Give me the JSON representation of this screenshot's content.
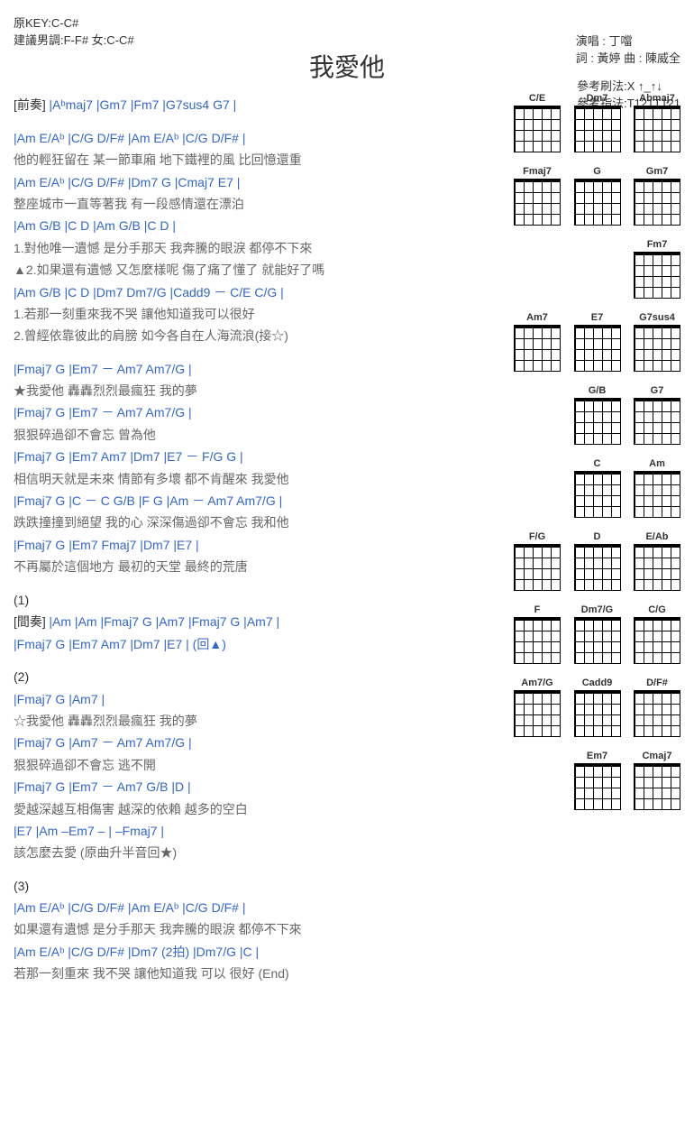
{
  "header": {
    "title": "我愛他",
    "original_key": "原KEY:C-C#",
    "suggest_key": "建議男調:F-F# 女:C-C#",
    "singer": "演唱 : 丁噹",
    "lyrics_composer": "詞 : 黃婷  曲 : 陳威全",
    "ref_strum": "參考刷法:X ↑_↑↓",
    "ref_finger": "參考指法:T121T121"
  },
  "intro": {
    "label": "[前奏]",
    "chords": " |Aᵇmaj7    |Gm7    |Fm7    |G7sus4    G7    |"
  },
  "verse1": [
    {
      "c": "|Am    E/Aᵇ    |C/G    D/F#    |Am    E/Aᵇ    |C/G    D/F#    |",
      "l": "他的輕狂留在    某一節車廂    地下鐵裡的風    比回憶還重"
    },
    {
      "c": "|Am    E/Aᵇ    |C/G    D/F#    |Dm7        G    |Cmaj7    E7    |",
      "l": "整座城市一直等著我        有一段感情還在漂泊"
    },
    {
      "c": "|Am        G/B    |C            D    |Am        G/B    |C            D    |",
      "l1": "1.對他唯一遺憾    是分手那天   我奔騰的眼淚    都停不下來",
      "l2": "▲2.如果還有遺憾    又怎麼樣呢    傷了痛了懂了    就能好了嗎"
    },
    {
      "c": "|Am        G/B    |C        D        |Dm7    Dm7/G    |Cadd9 － C/E    C/G  |",
      "l1": "1.若那一刻重來我不哭        讓他知道我可以很好",
      "l2": "2.曾經依靠彼此的肩膀        如今各自在人海流浪(接☆)"
    }
  ],
  "chorus": [
    {
      "pre": "                 |Fmaj7    G    |Em7 － Am7    Am7/G    |",
      "l": "★我愛他    轟轟烈烈最瘋狂      我的夢"
    },
    {
      "c": "|Fmaj7    G        |Em7 － Am7    Am7/G    |",
      "l": "狠狠碎過卻不會忘        曾為他"
    },
    {
      "c": "|Fmaj7    G        |Em7        Am7        |Dm7    |E7  －  F/G    G    |",
      "l": "相信明天就是未來    情節有多壞        都不肯醒來      我愛他"
    },
    {
      "c": "|Fmaj7    G    |C  －  C    G/B    |F      G       |Am  －  Am7    Am7/G  |",
      "l": "跌跌撞撞到絕望      我的心       深深傷過卻不會忘          我和他"
    },
    {
      "c": "|Fmaj7    G    |Em7    Fmaj7    |Dm7        |E7                |",
      "l": "不再屬於這個地方    最初的天堂    最終的荒唐"
    }
  ],
  "section1": {
    "label": "(1)"
  },
  "interlude": {
    "label": "[間奏]",
    "c1": " |Am    |Am    |Fmaj7    G    |Am7    |Fmaj7    G    |Am7    |",
    "c2": "            |Fmaj7    G    |Em7    Am7    |Dm7    |E7    |    (回▲)"
  },
  "section2": {
    "label": "(2)"
  },
  "chorus2": [
    {
      "pre": "                 |Fmaj7    G    |Am7    |",
      "l": "☆我愛他    轟轟烈烈最瘋狂      我的夢"
    },
    {
      "c": "|Fmaj7    G        |Am7 － Am7    Am7/G    |",
      "l": "狠狠碎過卻不會忘        逃不開"
    },
    {
      "c": "|Fmaj7    G        |Em7 － Am7    G/B    |D                |",
      "l": "愛越深越互相傷害    越深的依賴        越多的空白"
    },
    {
      "c": "|E7             |Am  –Em7 – | –Fmaj7  |",
      "l": "該怎麼去愛                                        (原曲升半音回★)"
    }
  ],
  "section3": {
    "label": "(3)"
  },
  "outro": [
    {
      "c": "|Am    E/Aᵇ    |C/G    D/F#    |Am    E/Aᵇ    |C/G    D/F#    |",
      "l": "如果還有遺憾    是分手那天    我奔騰的眼淚    都停不下來"
    },
    {
      "c": "|Am    E/Aᵇ    |C/G    D/F#    |Dm7    (2拍)  |Dm7/G    |C    |",
      "l": "若那一刻重來    我不哭    讓他知道我    可以    很好    (End)"
    }
  ],
  "chord_diagrams": [
    [
      "C/E",
      "Dm7",
      "Abmaj7"
    ],
    [
      "Fmaj7",
      "G",
      "Gm7"
    ],
    [
      "",
      "",
      "Fm7"
    ],
    [
      "Am7",
      "E7",
      "G7sus4"
    ],
    [
      "",
      "G/B",
      "G7"
    ],
    [
      "",
      "C",
      "Am"
    ],
    [
      "F/G",
      "D",
      "E/Ab"
    ],
    [
      "F",
      "Dm7/G",
      "C/G"
    ],
    [
      "Am7/G",
      "Cadd9",
      "D/F#"
    ],
    [
      "",
      "Em7",
      "Cmaj7"
    ]
  ]
}
